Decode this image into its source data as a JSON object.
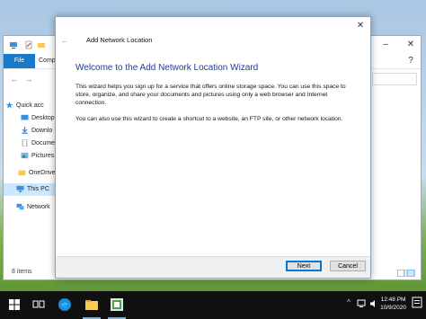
{
  "explorer": {
    "tabs": {
      "file": "File",
      "compose": "Compo"
    },
    "sidebar": [
      {
        "label": "Quick acc",
        "icon": "star-icon"
      },
      {
        "label": "Desktop",
        "icon": "desktop-icon"
      },
      {
        "label": "Downlo",
        "icon": "download-icon"
      },
      {
        "label": "Docume",
        "icon": "document-icon"
      },
      {
        "label": "Pictures",
        "icon": "pictures-icon"
      },
      {
        "label": "OneDrive",
        "icon": "onedrive-icon"
      },
      {
        "label": "This PC",
        "icon": "computer-icon"
      },
      {
        "label": "Network",
        "icon": "network-icon"
      }
    ],
    "status": "8 items"
  },
  "dialog": {
    "title": "Add Network Location",
    "heading": "Welcome to the Add Network Location Wizard",
    "paragraph1": "This wizard helps you sign up for a service that offers online storage space.  You can use this space to store, organize, and share your documents and pictures using only a web browser and Internet connection.",
    "paragraph2": "You can also use this wizard to create a shortcut to a website, an FTP site, or other network location.",
    "buttons": {
      "next": "Next",
      "cancel": "Cancel"
    }
  },
  "taskbar": {
    "time": "12:48 PM",
    "date": "10/9/2020"
  },
  "colors": {
    "accent": "#1979ca",
    "heading": "#1e3c97",
    "taskbar": "#101010"
  }
}
